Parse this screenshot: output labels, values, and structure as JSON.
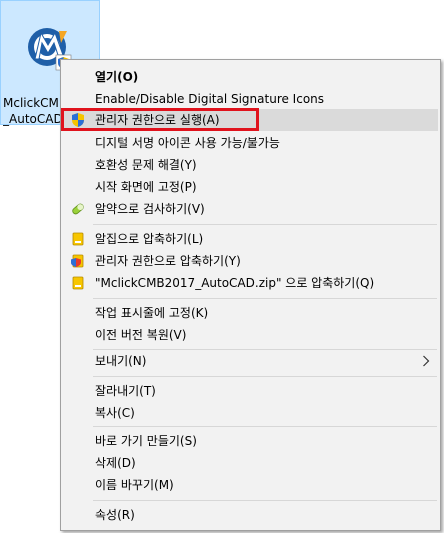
{
  "desktop": {
    "file": {
      "label_line1": "MclickCMB",
      "label_line2": "_AutoCAD",
      "icon": "mclick-app-icon"
    }
  },
  "context_menu": {
    "items": [
      {
        "label": "열기(O)",
        "bold": true,
        "icon": null
      },
      {
        "label": "Enable/Disable Digital Signature Icons",
        "icon": null
      },
      {
        "label": "관리자 권한으로 실행(A)",
        "icon": "uac-shield-icon",
        "highlighted": true
      },
      {
        "label": "디지털 서명 아이콘 사용 가능/불가능",
        "icon": null
      },
      {
        "label": "호환성 문제 해결(Y)",
        "icon": null
      },
      {
        "label": "시작 화면에 고정(P)",
        "icon": null
      },
      {
        "label": "알약으로 검사하기(V)",
        "icon": "alyac-pill-icon"
      },
      {
        "label": "알집으로 압축하기(L)",
        "icon": "alzip-icon"
      },
      {
        "label": "관리자 권한으로 압축하기(Y)",
        "icon": "alzip-admin-icon"
      },
      {
        "label": "\"MclickCMB2017_AutoCAD.zip\" 으로 압축하기(Q)",
        "icon": "alzip-icon"
      },
      {
        "label": "작업 표시줄에 고정(K)",
        "icon": null
      },
      {
        "label": "이전 버전 복원(V)",
        "icon": null
      },
      {
        "label": "보내기(N)",
        "icon": null,
        "submenu": true
      },
      {
        "label": "잘라내기(T)",
        "icon": null
      },
      {
        "label": "복사(C)",
        "icon": null
      },
      {
        "label": "바로 가기 만들기(S)",
        "icon": null
      },
      {
        "label": "삭제(D)",
        "icon": null
      },
      {
        "label": "이름 바꾸기(M)",
        "icon": null
      },
      {
        "label": "속성(R)",
        "icon": null
      }
    ]
  },
  "colors": {
    "selection_bg": "#cce8ff",
    "menu_bg": "#f2f2f2",
    "hover_bg": "#dadada",
    "highlight_border": "#e0131d"
  }
}
